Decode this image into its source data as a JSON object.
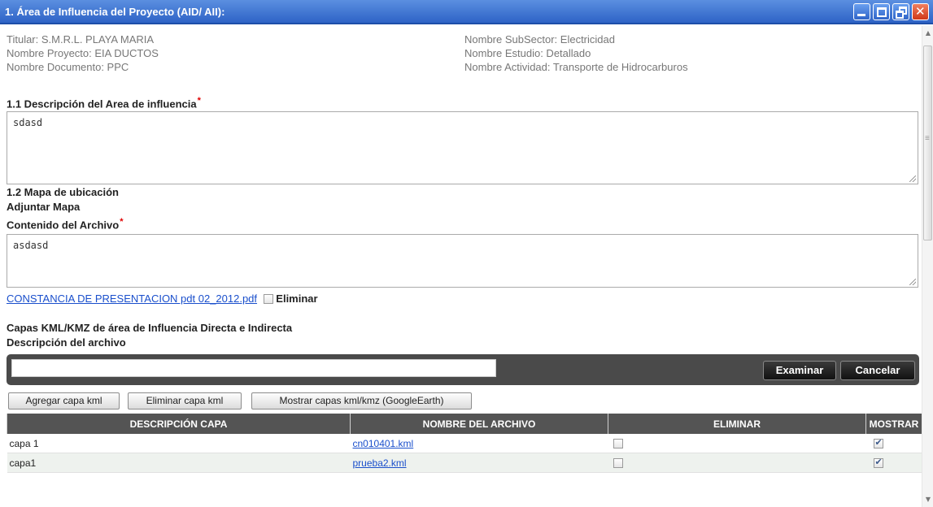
{
  "window": {
    "title": "1. Área de Influencia del Proyecto (AID/ AII):"
  },
  "meta": {
    "titular": "Titular: S.M.R.L. PLAYA MARIA",
    "proyecto": "Nombre Proyecto: EIA DUCTOS",
    "documento": "Nombre Documento: PPC",
    "subsector": "Nombre SubSector: Electricidad",
    "estudio": "Nombre Estudio: Detallado",
    "actividad": "Nombre Actividad: Transporte de Hidrocarburos"
  },
  "section_1_1": {
    "heading": "1.1 Descripción del Area de influencia",
    "required_mark": "*",
    "value": "sdasd"
  },
  "section_1_2": {
    "heading": "1.2 Mapa de ubicación",
    "adjuntar": "Adjuntar Mapa",
    "contenido_label": "Contenido del Archivo",
    "required_mark": "*",
    "contenido_value": "asdasd",
    "file_link": "CONSTANCIA DE PRESENTACION pdt 02_2012.pdf",
    "eliminar_label": "Eliminar",
    "eliminar_checked": false
  },
  "kml": {
    "heading": "Capas KML/KMZ de área de Influencia Directa e Indirecta",
    "desc_label": "Descripción del archivo",
    "desc_value": "",
    "file_value": "",
    "examinar": "Examinar",
    "cancelar": "Cancelar",
    "agregar": "Agregar capa kml",
    "eliminar_capa": "Eliminar capa kml",
    "mostrar": "Mostrar capas kml/kmz (GoogleEarth)"
  },
  "table": {
    "columns": [
      "DESCRIPCIÓN CAPA",
      "NOMBRE DEL ARCHIVO",
      "ELIMINAR",
      "MOSTRAR"
    ],
    "rows": [
      {
        "descripcion": "capa 1",
        "archivo": "cn010401.kml",
        "eliminar": false,
        "mostrar": true
      },
      {
        "descripcion": "capa1",
        "archivo": "prueba2.kml",
        "eliminar": false,
        "mostrar": true
      }
    ]
  },
  "colors": {
    "titlebar": "#2e63c6",
    "link": "#1a4fcc",
    "required": "#e00000",
    "dark_bar": "#4a4a4a"
  }
}
